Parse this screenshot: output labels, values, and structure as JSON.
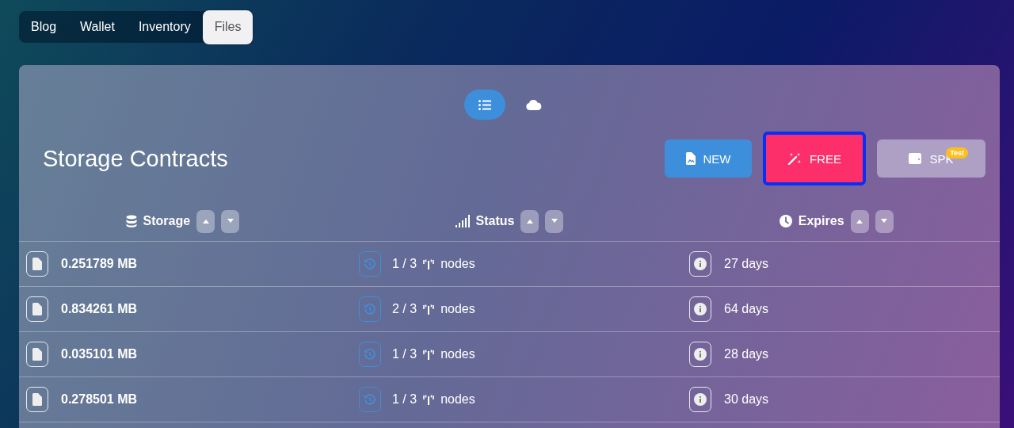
{
  "tabs": [
    {
      "label": "Blog",
      "selected": false
    },
    {
      "label": "Wallet",
      "selected": false
    },
    {
      "label": "Inventory",
      "selected": false
    },
    {
      "label": "Files",
      "selected": true
    }
  ],
  "view_toggle": [
    {
      "kind": "list",
      "selected": true
    },
    {
      "kind": "cloud",
      "selected": false
    }
  ],
  "title": "Storage Contracts",
  "actions": [
    {
      "kind": "new",
      "label": "NEW",
      "focused": false
    },
    {
      "kind": "free",
      "label": "FREE",
      "focused": true
    },
    {
      "kind": "spk",
      "label": "SPK",
      "badge": "Test",
      "focused": false
    }
  ],
  "table": {
    "columns": [
      {
        "kind": "storage",
        "label": "Storage"
      },
      {
        "kind": "status",
        "label": "Status"
      },
      {
        "kind": "expires",
        "label": "Expires"
      }
    ],
    "rows": [
      {
        "size": "0.251789 MB",
        "nodes": "1 / 3",
        "nodes_label": "nodes",
        "expires": "27 days"
      },
      {
        "size": "0.834261 MB",
        "nodes": "2 / 3",
        "nodes_label": "nodes",
        "expires": "64 days"
      },
      {
        "size": "0.035101 MB",
        "nodes": "1 / 3",
        "nodes_label": "nodes",
        "expires": "28 days"
      },
      {
        "size": "0.278501 MB",
        "nodes": "1 / 3",
        "nodes_label": "nodes",
        "expires": "30 days"
      }
    ]
  }
}
